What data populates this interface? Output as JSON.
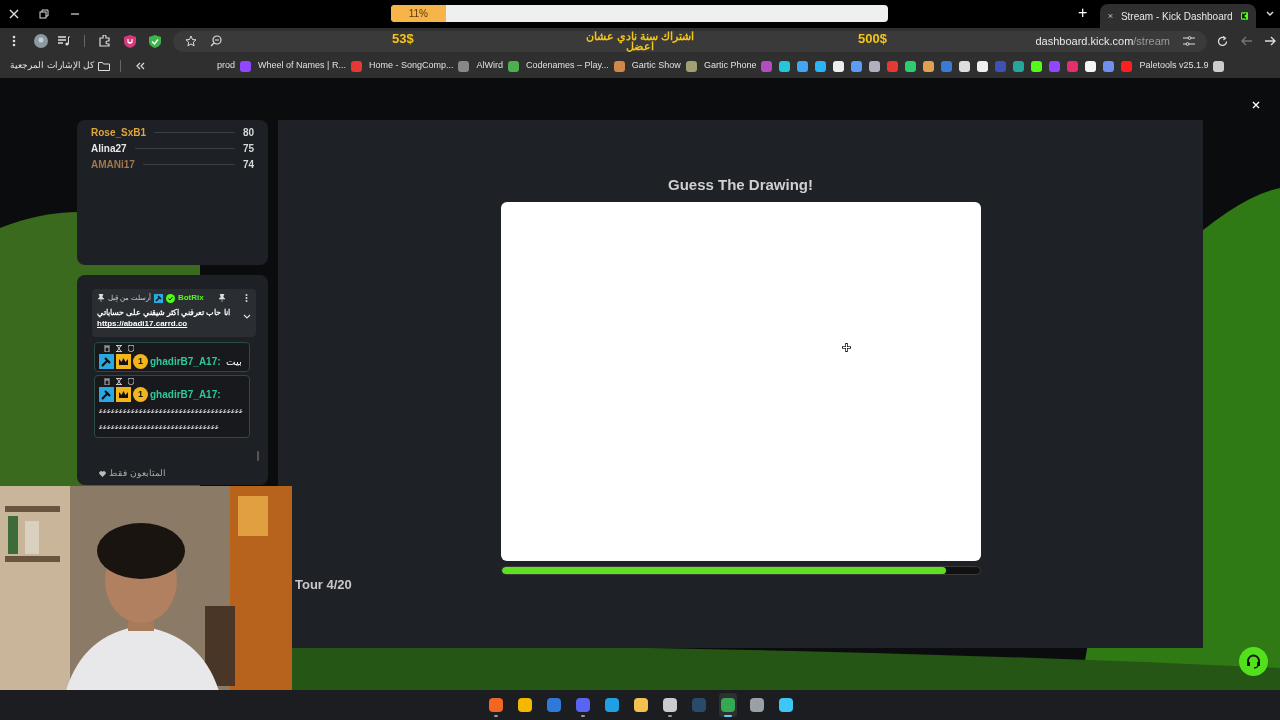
{
  "overlay": {
    "goal": {
      "level": 0.11
    },
    "goal_percent": "11%",
    "left_amount": "53$",
    "goal_text": "اشتراك سنة نادي عشان اعضل",
    "right_amount": "500$"
  },
  "new_tab": "+",
  "tab": {
    "title": "Stream - Kick Dashboard",
    "selected": true
  },
  "address_bar": {
    "url_host": "dashboard.kick.com",
    "url_path": "/stream"
  },
  "bookmarks_all": "كل الإشارات المرجعية",
  "bookmarks": [
    {
      "label": "prod",
      "color": "#9146ff"
    },
    {
      "label": "Wheel of Names | R...",
      "color": "#e53935"
    },
    {
      "label": "Home - SongComp...",
      "color": "#888888"
    },
    {
      "label": "AlWird",
      "color": "#4caf50"
    },
    {
      "label": "Codenames – Play...",
      "color": "#d0884a"
    },
    {
      "label": "Gartic Show",
      "color": "#a0a070"
    },
    {
      "label": "Gartic Phone",
      "color": "#b04ec0"
    },
    {
      "color": "#26c6da"
    },
    {
      "color": "#42a5f5"
    },
    {
      "color": "#29b6f6"
    },
    {
      "color": "#eeeeee"
    },
    {
      "color": "#5c9cf5"
    },
    {
      "color": "#b0b0c0"
    },
    {
      "color": "#e53935"
    },
    {
      "color": "#2ecc71"
    },
    {
      "color": "#e0a050"
    },
    {
      "color": "#3b7bd8"
    },
    {
      "color": "#dddddd"
    },
    {
      "color": "#f0f0f0"
    },
    {
      "color": "#3f51b5"
    },
    {
      "color": "#26a69a"
    },
    {
      "color": "#53fc18"
    },
    {
      "color": "#9146ff"
    },
    {
      "color": "#e1306c"
    },
    {
      "color": "#f5f5f5"
    },
    {
      "color": "#6f8ff0"
    },
    {
      "color": "#ff1f1f"
    },
    {
      "label": "Paletools v25.1.9",
      "color": "#cccccc"
    }
  ],
  "leaderboard": [
    {
      "name": "Rose_SxB1",
      "score": "80",
      "color": "#e0a63a"
    },
    {
      "name": "Alina27",
      "score": "75",
      "color": "#e6e6e6"
    },
    {
      "name": "AMANi17",
      "score": "74",
      "color": "#a07850"
    }
  ],
  "chat": {
    "pinned": {
      "sent_by": "أرسلت من قِبل",
      "sender": "BotRix",
      "message": "انا حاب تعرفني اكثر شيقني على حساباتي",
      "link": "https://abadi17.carrd.co"
    },
    "messages": [
      {
        "username": "ghadirB7_A17:",
        "badge": "1",
        "text": "بيت"
      },
      {
        "username": "ghadirB7_A17:",
        "badge": "1",
        "text": "ﻋﻋﻋﻋﻋﻋﻋﻋﻋﻋﻋﻋﻋﻋﻋﻋﻋﻋﻋﻋﻋﻋﻋﻋﻋﻋﻋﻋﻋﻋﻋﻋﻋﻋﻋﻋﻋﻋﻋﻋﻋﻋﻋﻋﻋﻋﻋﻋﻋﻋﻋﻋﻋﻋﻋﻋﻋﻋﻋﻋﻋﻋﻋﻋﻋﻋ"
      }
    ],
    "mode": "المتابعون فقط"
  },
  "game": {
    "title": "Guess The Drawing!",
    "timer": {
      "level": 0.93
    },
    "round": "Tour 4/20"
  },
  "taskbar": [
    {
      "color": "#f26522",
      "running": true,
      "selected": false
    },
    {
      "color": "#f5b800",
      "running": false,
      "selected": false
    },
    {
      "color": "#2f7ad8",
      "running": false,
      "selected": false
    },
    {
      "color": "#5865f2",
      "running": true,
      "selected": false
    },
    {
      "color": "#1fa0e0",
      "running": false,
      "selected": false
    },
    {
      "color": "#f2c14e",
      "running": false,
      "selected": false
    },
    {
      "color": "#cccccc",
      "running": true,
      "selected": false
    },
    {
      "color": "#2a4a6a",
      "running": false,
      "selected": false
    },
    {
      "color": "#34a853",
      "running": true,
      "selected": true
    },
    {
      "color": "#9aa0a6",
      "running": false,
      "selected": false
    },
    {
      "color": "#3ec7f5",
      "running": false,
      "selected": false
    }
  ]
}
